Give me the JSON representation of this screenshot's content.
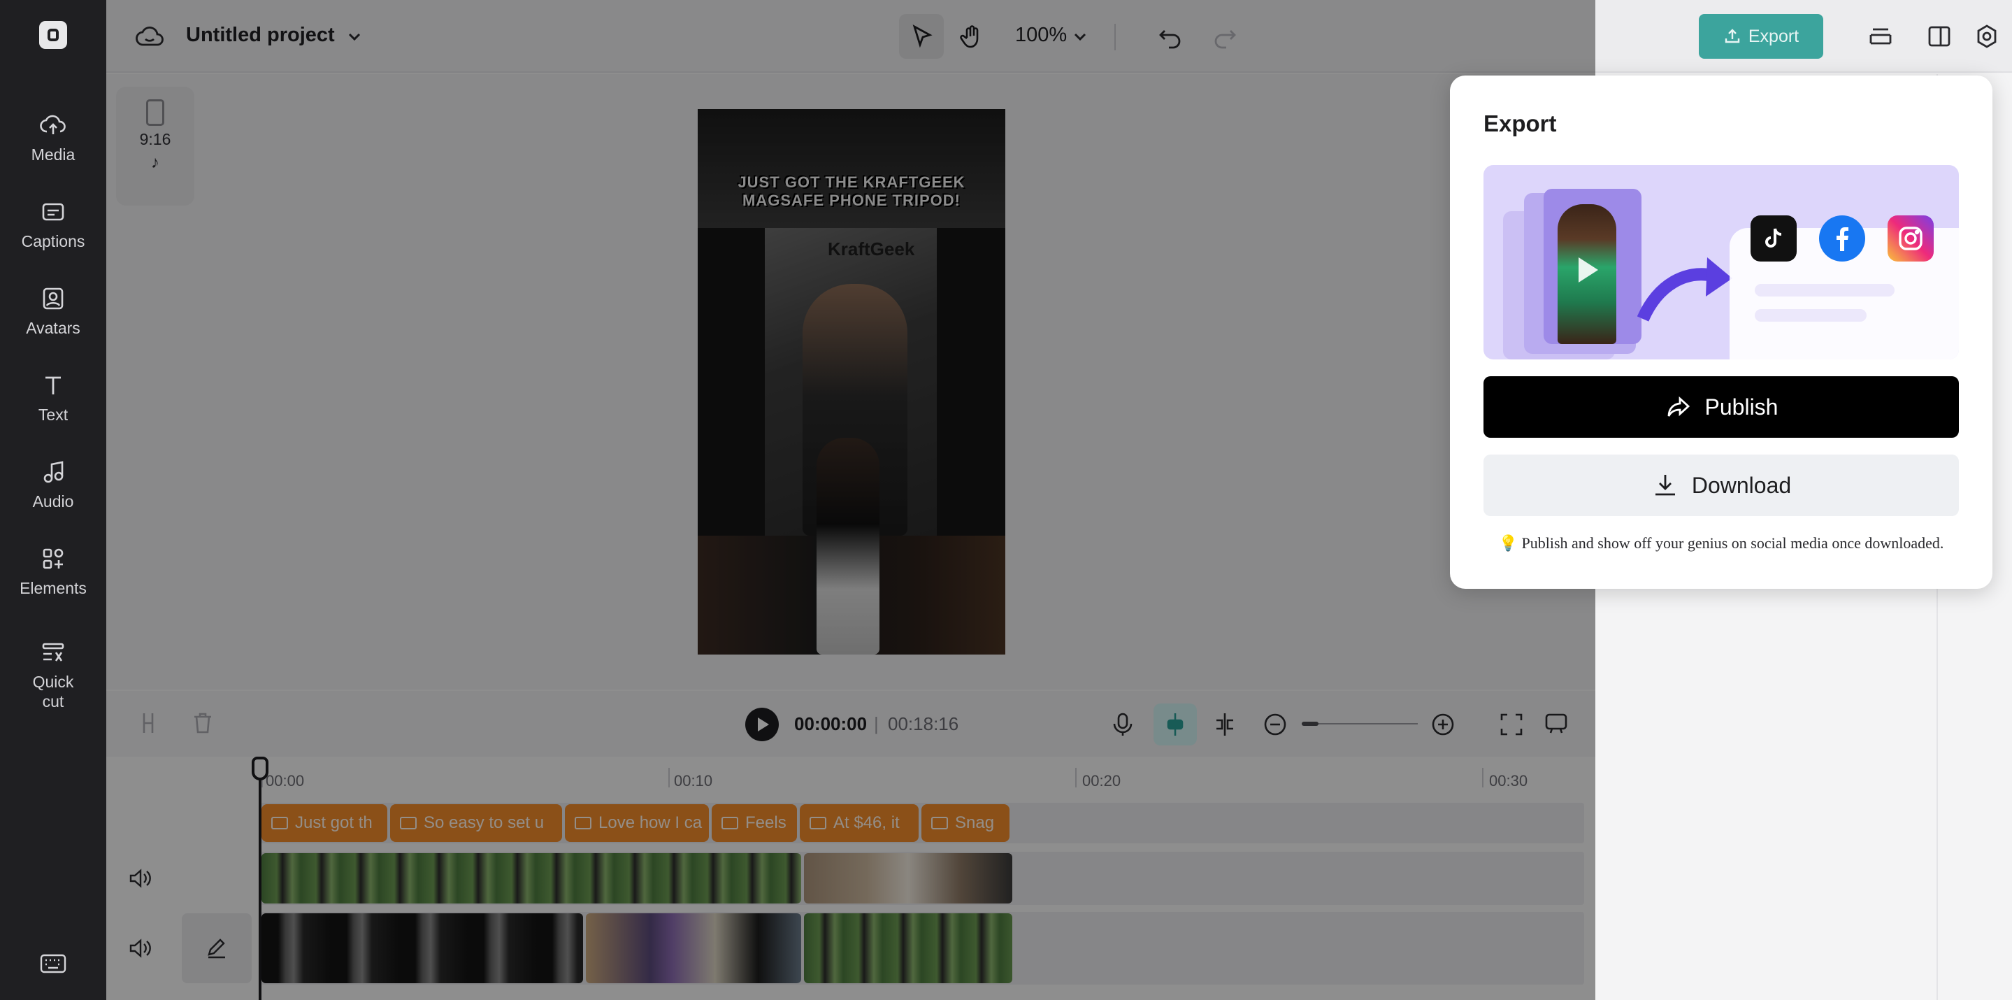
{
  "sidebar": {
    "items": [
      {
        "label": "Media",
        "icon": "cloud-upload-icon"
      },
      {
        "label": "Captions",
        "icon": "captions-icon"
      },
      {
        "label": "Avatars",
        "icon": "avatar-icon"
      },
      {
        "label": "Text",
        "icon": "text-icon"
      },
      {
        "label": "Audio",
        "icon": "music-note-icon"
      },
      {
        "label": "Elements",
        "icon": "elements-icon"
      },
      {
        "label": "Quick\ncut",
        "icon": "quick-cut-icon"
      }
    ]
  },
  "header": {
    "project_title": "Untitled project",
    "zoom": "100%",
    "export_label": "Export"
  },
  "canvas": {
    "ratio": "9:16",
    "video_caption": "JUST GOT THE KRAFTGEEK MAGSAFE PHONE TRIPOD!",
    "video_logo": "KraftGeek"
  },
  "timeline": {
    "current_time": "00:00:00",
    "separator": "|",
    "total_time": "00:18:16",
    "ticks": [
      "00:00",
      "00:10",
      "00:20",
      "00:30"
    ],
    "captions": [
      "Just got th",
      "So easy to set u",
      "Love how I ca",
      "Feels",
      "At $46, it",
      "Snag"
    ]
  },
  "export_panel": {
    "title": "Export",
    "publish_label": "Publish",
    "download_label": "Download",
    "tip": "Publish and show off your genius on social media once downloaded."
  },
  "colors": {
    "accent": "#2a9d95",
    "caption_clip": "#f08a2a",
    "sidebar_bg": "#1f1f22"
  }
}
